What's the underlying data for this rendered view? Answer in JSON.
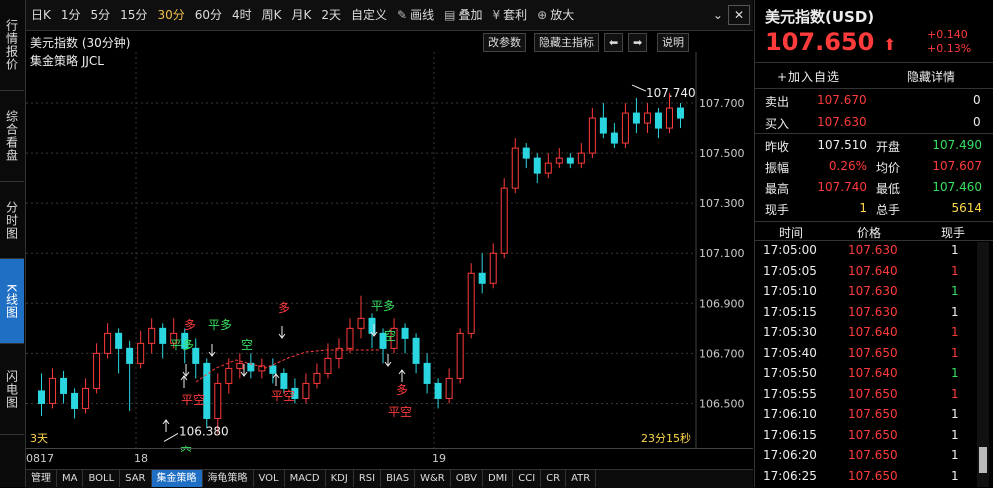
{
  "left_nav": [
    {
      "label": "行情报价",
      "active": false
    },
    {
      "label": "综合看盘",
      "active": false
    },
    {
      "label": "分时图",
      "active": false
    },
    {
      "label": "K线图",
      "active": true
    },
    {
      "label": "闪电图",
      "active": false
    }
  ],
  "toolbar": {
    "periods": [
      "日K",
      "1分",
      "5分",
      "15分",
      "30分",
      "60分",
      "4时",
      "周K",
      "月K",
      "2天",
      "自定义"
    ],
    "active_period": "30分",
    "tools": [
      {
        "icon": "pencil-icon",
        "label": "画线"
      },
      {
        "icon": "layers-icon",
        "label": "叠加"
      },
      {
        "icon": "bag-icon",
        "label": "套利"
      },
      {
        "icon": "zoom-icon",
        "label": "放大"
      }
    ]
  },
  "chart_header": {
    "title": "美元指数 (30分钟)",
    "subtitle": "集金策略 JJCL",
    "buttons": [
      "改参数",
      "隐藏主指标",
      "说明"
    ]
  },
  "chart_info": {
    "bottom_left": "3天",
    "bottom_right": "23分15秒",
    "max_label": "107.740",
    "min_label": "106.380",
    "x_labels": [
      "0817",
      "18",
      "19"
    ]
  },
  "signals": {
    "labels": [
      "平多",
      "多",
      "平多",
      "空",
      "平空",
      "平空",
      "多",
      "平多",
      "空",
      "多",
      "平空",
      "空"
    ]
  },
  "chart_data": {
    "type": "candlestick",
    "title": "美元指数 (30分钟)",
    "y_ticks": [
      106.5,
      106.7,
      106.9,
      107.1,
      107.3,
      107.5,
      107.7
    ],
    "y_tick_labels": [
      "106.500",
      "106.700",
      "106.900",
      "107.100",
      "107.300",
      "107.500",
      "107.700"
    ],
    "ylim": [
      106.33,
      107.84
    ],
    "x_labels": [
      "0817",
      "18",
      "19"
    ],
    "high": 107.74,
    "low": 106.38,
    "candles": [
      [
        106.55,
        106.5,
        106.62,
        106.45
      ],
      [
        106.5,
        106.6,
        106.64,
        106.48
      ],
      [
        106.6,
        106.54,
        106.63,
        106.5
      ],
      [
        106.54,
        106.48,
        106.56,
        106.44
      ],
      [
        106.48,
        106.56,
        106.6,
        106.46
      ],
      [
        106.56,
        106.7,
        106.74,
        106.54
      ],
      [
        106.7,
        106.78,
        106.82,
        106.68
      ],
      [
        106.78,
        106.72,
        106.8,
        106.62
      ],
      [
        106.72,
        106.66,
        106.75,
        106.47
      ],
      [
        106.66,
        106.74,
        106.79,
        106.64
      ],
      [
        106.74,
        106.8,
        106.84,
        106.7
      ],
      [
        106.8,
        106.74,
        106.82,
        106.68
      ],
      [
        106.74,
        106.78,
        106.84,
        106.72
      ],
      [
        106.78,
        106.72,
        106.8,
        106.66
      ],
      [
        106.72,
        106.66,
        106.76,
        106.6
      ],
      [
        106.66,
        106.44,
        106.68,
        106.4
      ],
      [
        106.44,
        106.58,
        106.62,
        106.38
      ],
      [
        106.58,
        106.64,
        106.68,
        106.54
      ],
      [
        106.64,
        106.66,
        106.7,
        106.6
      ],
      [
        106.66,
        106.63,
        106.7,
        106.6
      ],
      [
        106.63,
        106.65,
        106.68,
        106.6
      ],
      [
        106.65,
        106.62,
        106.68,
        106.58
      ],
      [
        106.62,
        106.56,
        106.64,
        106.54
      ],
      [
        106.56,
        106.52,
        106.6,
        106.5
      ],
      [
        106.52,
        106.58,
        106.62,
        106.5
      ],
      [
        106.58,
        106.62,
        106.66,
        106.56
      ],
      [
        106.62,
        106.68,
        106.74,
        106.6
      ],
      [
        106.68,
        106.72,
        106.76,
        106.64
      ],
      [
        106.72,
        106.8,
        106.84,
        106.7
      ],
      [
        106.8,
        106.84,
        106.93,
        106.76
      ],
      [
        106.84,
        106.78,
        106.86,
        106.72
      ],
      [
        106.78,
        106.72,
        106.8,
        106.66
      ],
      [
        106.72,
        106.8,
        106.84,
        106.7
      ],
      [
        106.8,
        106.76,
        106.82,
        106.7
      ],
      [
        106.76,
        106.66,
        106.78,
        106.62
      ],
      [
        106.66,
        106.58,
        106.7,
        106.54
      ],
      [
        106.58,
        106.52,
        106.6,
        106.48
      ],
      [
        106.52,
        106.6,
        106.64,
        106.5
      ],
      [
        106.6,
        106.78,
        106.8,
        106.58
      ],
      [
        106.78,
        107.02,
        107.06,
        106.76
      ],
      [
        107.02,
        106.98,
        107.1,
        106.94
      ],
      [
        106.98,
        107.1,
        107.14,
        106.96
      ],
      [
        107.1,
        107.36,
        107.4,
        107.08
      ],
      [
        107.36,
        107.52,
        107.56,
        107.34
      ],
      [
        107.52,
        107.48,
        107.54,
        107.44
      ],
      [
        107.48,
        107.42,
        107.5,
        107.38
      ],
      [
        107.42,
        107.46,
        107.5,
        107.4
      ],
      [
        107.46,
        107.48,
        107.52,
        107.44
      ],
      [
        107.48,
        107.46,
        107.5,
        107.44
      ],
      [
        107.46,
        107.5,
        107.54,
        107.44
      ],
      [
        107.5,
        107.64,
        107.68,
        107.48
      ],
      [
        107.64,
        107.58,
        107.7,
        107.56
      ],
      [
        107.58,
        107.54,
        107.62,
        107.52
      ],
      [
        107.54,
        107.66,
        107.7,
        107.52
      ],
      [
        107.66,
        107.62,
        107.72,
        107.58
      ],
      [
        107.62,
        107.66,
        107.7,
        107.58
      ],
      [
        107.66,
        107.6,
        107.68,
        107.56
      ],
      [
        107.6,
        107.68,
        107.74,
        107.58
      ],
      [
        107.68,
        107.64,
        107.7,
        107.6
      ]
    ]
  },
  "quote": {
    "title": "美元指数(USD)",
    "price": "107.650",
    "change": "+0.140",
    "change_pct": "+0.13%",
    "add_watch": "+加入自选",
    "hide_detail": "隐藏详情",
    "sell_label": "卖出",
    "sell_price": "107.670",
    "sell_vol": "0",
    "buy_label": "买入",
    "buy_price": "107.630",
    "buy_vol": "0",
    "stats": [
      {
        "l1": "昨收",
        "v1": "107.510",
        "c1": "white",
        "l2": "开盘",
        "v2": "107.490",
        "c2": "green"
      },
      {
        "l1": "振幅",
        "v1": "0.26%",
        "c1": "red",
        "l2": "均价",
        "v2": "107.607",
        "c2": "red"
      },
      {
        "l1": "最高",
        "v1": "107.740",
        "c1": "red",
        "l2": "最低",
        "v2": "107.460",
        "c2": "green"
      },
      {
        "l1": "现手",
        "v1": "1",
        "c1": "yellow",
        "l2": "总手",
        "v2": "5614",
        "c2": "yellow"
      }
    ],
    "trade_headers": [
      "时间",
      "价格",
      "现手"
    ],
    "trades": [
      {
        "t": "17:05:00",
        "p": "107.630",
        "v": "1",
        "pc": "red",
        "vc": "white"
      },
      {
        "t": "17:05:05",
        "p": "107.640",
        "v": "1",
        "pc": "red",
        "vc": "red"
      },
      {
        "t": "17:05:10",
        "p": "107.630",
        "v": "1",
        "pc": "red",
        "vc": "green"
      },
      {
        "t": "17:05:15",
        "p": "107.630",
        "v": "1",
        "pc": "red",
        "vc": "white"
      },
      {
        "t": "17:05:30",
        "p": "107.640",
        "v": "1",
        "pc": "red",
        "vc": "red"
      },
      {
        "t": "17:05:40",
        "p": "107.650",
        "v": "1",
        "pc": "red",
        "vc": "red"
      },
      {
        "t": "17:05:50",
        "p": "107.640",
        "v": "1",
        "pc": "red",
        "vc": "green"
      },
      {
        "t": "17:05:55",
        "p": "107.650",
        "v": "1",
        "pc": "red",
        "vc": "red"
      },
      {
        "t": "17:06:10",
        "p": "107.650",
        "v": "1",
        "pc": "red",
        "vc": "white"
      },
      {
        "t": "17:06:15",
        "p": "107.650",
        "v": "1",
        "pc": "red",
        "vc": "white"
      },
      {
        "t": "17:06:20",
        "p": "107.650",
        "v": "1",
        "pc": "red",
        "vc": "white"
      },
      {
        "t": "17:06:25",
        "p": "107.650",
        "v": "1",
        "pc": "red",
        "vc": "white"
      }
    ]
  },
  "bottom_tabs": [
    "管理",
    "MA",
    "BOLL",
    "SAR",
    "集金策略",
    "海龟策略",
    "VOL",
    "MACD",
    "KDJ",
    "RSI",
    "BIAS",
    "W&R",
    "OBV",
    "DMI",
    "CCI",
    "CR",
    "ATR"
  ],
  "active_bottom_tab": "集金策略"
}
